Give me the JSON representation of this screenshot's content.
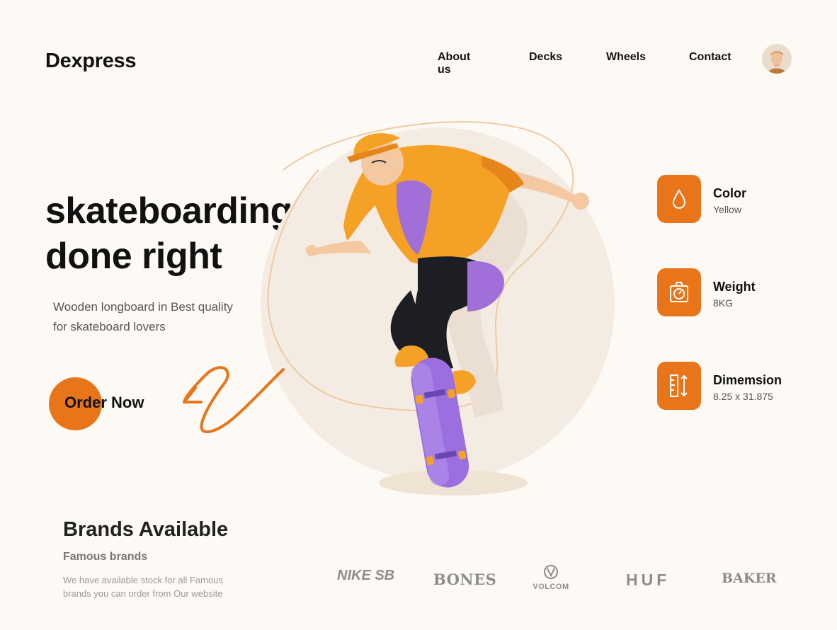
{
  "header": {
    "logo": "Dexpress",
    "nav": [
      {
        "label": "About us"
      },
      {
        "label": "Decks"
      },
      {
        "label": "Wheels"
      },
      {
        "label": "Contact"
      }
    ]
  },
  "hero": {
    "title_line1": "skateboarding",
    "title_line2": "done right",
    "subtitle": "Wooden longboard in Best quality for skateboard lovers",
    "cta_label": "Order Now"
  },
  "specs": [
    {
      "name": "Color",
      "value": "Yellow",
      "icon": "drop-icon"
    },
    {
      "name": "Weight",
      "value": "8KG",
      "icon": "scale-icon"
    },
    {
      "name": "Dimemsion",
      "value": "8.25 x 31.875",
      "icon": "ruler-icon"
    }
  ],
  "brands": {
    "title": "Brands Available",
    "subtitle": "Famous brands",
    "description": "We have available stock for all Famous brands you can order from Our website",
    "logos": [
      {
        "name": "NIKE SB"
      },
      {
        "name": "BONES"
      },
      {
        "name": "VOLCOM"
      },
      {
        "name": "HUF"
      },
      {
        "name": "BAKER"
      }
    ]
  },
  "colors": {
    "accent": "#e8751a",
    "background": "#fdfaf5",
    "skateboard": "#9b6fe0",
    "text": "#111111"
  }
}
